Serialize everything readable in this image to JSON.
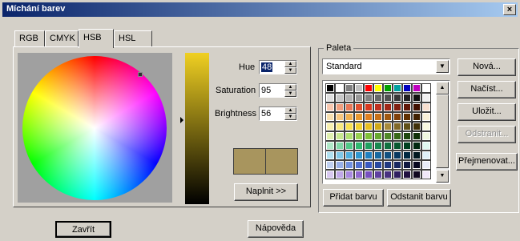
{
  "window": {
    "title": "Míchání barev",
    "close_glyph": "×"
  },
  "tabs": [
    {
      "label": "RGB"
    },
    {
      "label": "CMYK"
    },
    {
      "label": "HSB",
      "active": true
    },
    {
      "label": "HSL"
    }
  ],
  "hsb": {
    "hue_label": "Hue",
    "hue_value": "48",
    "saturation_label": "Saturation",
    "saturation_value": "95",
    "brightness_label": "Brightness",
    "brightness_value": "56",
    "apply_button": "Naplnit >>"
  },
  "palette": {
    "group_label": "Paleta",
    "selected": "Standard",
    "new_button": "Nová...",
    "load_button": "Načíst...",
    "save_button": "Uložit...",
    "remove_button": "Odstranit...",
    "rename_button": "Přejmenovat...",
    "add_color_button": "Přidat barvu",
    "remove_color_button": "Odstanit barvu"
  },
  "footer": {
    "close_button": "Zavřít",
    "help_button": "Nápověda"
  },
  "colors": {
    "current": "#a8955e",
    "palette_rows": [
      [
        "#000000",
        "#ffffff",
        "#808080",
        "#c0c0c0",
        "#ff0000",
        "#ffff00",
        "#00a000",
        "#00a0a0",
        "#0000c0",
        "#c000c0",
        "#ffffff"
      ],
      [
        "#e0e0e0",
        "#c8c8c8",
        "#b0b0b0",
        "#989898",
        "#808080",
        "#686868",
        "#505050",
        "#383838",
        "#202020",
        "#101010",
        "#f0f0f0"
      ],
      [
        "#f8c8b0",
        "#f0a080",
        "#e87858",
        "#e05030",
        "#d83820",
        "#c03020",
        "#a02818",
        "#802010",
        "#601808",
        "#401000",
        "#f8e0d0"
      ],
      [
        "#f8e0b0",
        "#f8c880",
        "#f0b050",
        "#e89830",
        "#e08020",
        "#c87018",
        "#a05810",
        "#804008",
        "#603000",
        "#402000",
        "#f8f0d8"
      ],
      [
        "#f8f0b0",
        "#f8e880",
        "#f8e050",
        "#f0d030",
        "#e8c020",
        "#d0a818",
        "#a88a3a",
        "#806828",
        "#605018",
        "#403008",
        "#f8f8e0"
      ],
      [
        "#e0f0b0",
        "#c8e890",
        "#b0e070",
        "#98d050",
        "#80c038",
        "#68a830",
        "#508828",
        "#386818",
        "#204810",
        "#103008",
        "#f0f8e0"
      ],
      [
        "#b0e8c8",
        "#80d8a8",
        "#50c888",
        "#30b870",
        "#20a060",
        "#188850",
        "#107040",
        "#085830",
        "#004020",
        "#002810",
        "#e0f8f0"
      ],
      [
        "#b0e0f0",
        "#80c8e8",
        "#50b0e0",
        "#3098d0",
        "#2080c0",
        "#1868a0",
        "#105080",
        "#083860",
        "#002840",
        "#001820",
        "#e0f0f8"
      ],
      [
        "#c0d0f0",
        "#98b0e8",
        "#7090e0",
        "#5070d0",
        "#3858c0",
        "#2848a0",
        "#203880",
        "#182860",
        "#101840",
        "#080820",
        "#e8ecf8"
      ],
      [
        "#d8c8f0",
        "#c0a8e8",
        "#a888e0",
        "#9068d0",
        "#7850c0",
        "#6040a0",
        "#483080",
        "#302060",
        "#201040",
        "#100820",
        "#f0e8f8"
      ]
    ]
  }
}
